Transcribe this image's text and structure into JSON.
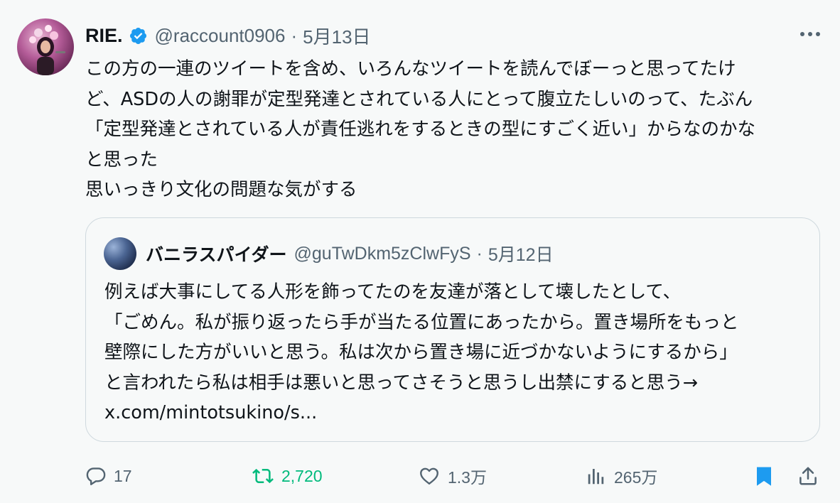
{
  "tweet": {
    "author_name": "RIE.",
    "handle": "@raccount0906",
    "separator": "·",
    "date": "5月13日",
    "body_lines": [
      "この方の一連のツイートを含め、いろんなツイートを読んでぼーっと思ってたけ",
      "ど、ASDの人の謝罪が定型発達とされている人にとって腹立たしいのって、たぶん",
      "「定型発達とされている人が責任逃れをするときの型にすごく近い」からなのかな",
      "と思った",
      "思いっきり文化の問題な気がする"
    ],
    "icons": {
      "verified": "verified-badge-icon",
      "more": "more-icon"
    },
    "colors": {
      "verified": "#1d9bf0",
      "retweet": "#00ba7c",
      "bookmark": "#1d9bf0",
      "muted": "#536471",
      "text": "#0f1419"
    }
  },
  "quote": {
    "author_name": "バニラスパイダー",
    "handle": "@guTwDkm5zClwFyS",
    "separator": "·",
    "date": "5月12日",
    "body_lines": [
      "例えば大事にしてる人形を飾ってたのを友達が落として壊したとして、",
      "「ごめん。私が振り返ったら手が当たる位置にあったから。置き場所をもっと",
      "壁際にした方がいいと思う。私は次から置き場に近づかないようにするから」",
      "と言われたら私は相手は悪いと思ってさそうと思うし出禁にすると思う→",
      "x.com/mintotsukino/s..."
    ]
  },
  "actions": {
    "reply": {
      "icon": "reply-icon",
      "count": "17"
    },
    "retweet": {
      "icon": "retweet-icon",
      "count": "2,720"
    },
    "like": {
      "icon": "heart-icon",
      "count": "1.3万"
    },
    "views": {
      "icon": "views-icon",
      "count": "265万"
    },
    "bookmark": {
      "icon": "bookmark-icon"
    },
    "share": {
      "icon": "share-icon"
    }
  }
}
